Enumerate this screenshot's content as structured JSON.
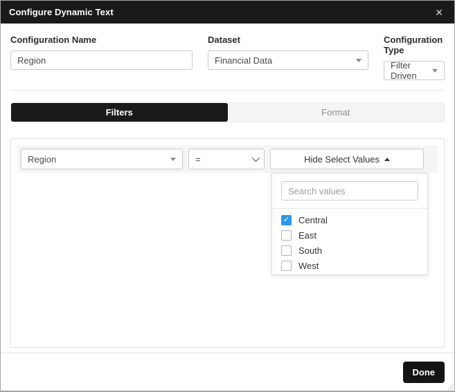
{
  "dialog": {
    "title": "Configure Dynamic Text",
    "close_glyph": "✕"
  },
  "fields": {
    "configuration_name": {
      "label": "Configuration Name",
      "value": "Region"
    },
    "dataset": {
      "label": "Dataset",
      "value": "Financial Data"
    },
    "configuration_type": {
      "label": "Configuration Type",
      "value": "Filter Driven"
    }
  },
  "tabs": {
    "filters_label": "Filters",
    "format_label": "Format",
    "active_tab": "Filters"
  },
  "filter_row": {
    "field_value": "Region",
    "operator_value": "=",
    "values_button_label": "Hide Select Values"
  },
  "values_popover": {
    "search_placeholder": "Search values",
    "options": [
      {
        "label": "Central",
        "checked": true
      },
      {
        "label": "East",
        "checked": false
      },
      {
        "label": "South",
        "checked": false
      },
      {
        "label": "West",
        "checked": false
      }
    ]
  },
  "footer": {
    "done_label": "Done"
  },
  "colors": {
    "header_bg": "#1a1a1a",
    "active_tab_bg": "#1a1a1a",
    "checkbox_checked": "#2b96f1",
    "done_button_bg": "#141414"
  }
}
